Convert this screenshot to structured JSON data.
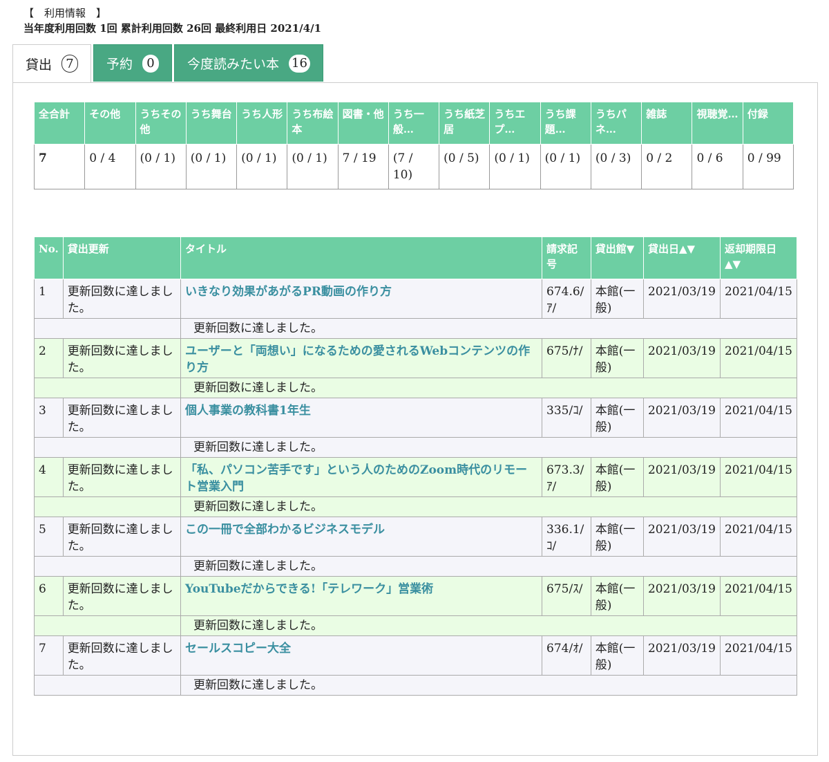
{
  "info": {
    "header": "【　利用情報　】",
    "stats_line": "当年度利用回数 1回  累計利用回数 26回  最終利用日 2021/4/1"
  },
  "tabs": [
    {
      "label": "貸出",
      "count": "7"
    },
    {
      "label": "予約",
      "count": "0"
    },
    {
      "label": "今度読みたい本",
      "count": "16"
    }
  ],
  "summary": {
    "headers": [
      "全合計",
      "その他",
      "うちその他",
      "うち舞台",
      "うち人形",
      "うち布絵本",
      "図書・他",
      "うち一般…",
      "うち紙芝居",
      "うちエプ…",
      "うち課題…",
      "うちパネ…",
      "雑誌",
      "視聴覚…",
      "付録"
    ],
    "values": [
      "7",
      "0 / 4",
      "(0 / 1)",
      "(0 / 1)",
      "(0 / 1)",
      "(0 / 1)",
      "7 / 19",
      "(7 / 10)",
      "(0 / 5)",
      "(0 / 1)",
      "(0 / 1)",
      "(0 / 3)",
      "0 / 2",
      "0 / 6",
      "0 / 99"
    ]
  },
  "loans": {
    "headers": [
      "No.",
      "貸出更新",
      "タイトル",
      "請求記号",
      "貸出館▼",
      "貸出日▲▼",
      "返却期限日▲▼"
    ],
    "rows": [
      {
        "no": "1",
        "renew": "更新回数に達しました。",
        "title": "いきなり効果があがるPR動画の作り方",
        "call": "674.6/ｱ/",
        "branch": "本館(一般)",
        "loan_date": "2021/03/19",
        "due": "2021/04/15",
        "note": "更新回数に達しました。"
      },
      {
        "no": "2",
        "renew": "更新回数に達しました。",
        "title": "ユーザーと「両想い」になるための愛されるWebコンテンツの作り方",
        "call": "675/ﾅ/",
        "branch": "本館(一般)",
        "loan_date": "2021/03/19",
        "due": "2021/04/15",
        "note": "更新回数に達しました。"
      },
      {
        "no": "3",
        "renew": "更新回数に達しました。",
        "title": "個人事業の教科書1年生",
        "call": "335/ｺ/",
        "branch": "本館(一般)",
        "loan_date": "2021/03/19",
        "due": "2021/04/15",
        "note": "更新回数に達しました。"
      },
      {
        "no": "4",
        "renew": "更新回数に達しました。",
        "title": "「私、パソコン苦手です」という人のためのZoom時代のリモート営業入門",
        "call": "673.3/ｱ/",
        "branch": "本館(一般)",
        "loan_date": "2021/03/19",
        "due": "2021/04/15",
        "note": "更新回数に達しました。"
      },
      {
        "no": "5",
        "renew": "更新回数に達しました。",
        "title": "この一冊で全部わかるビジネスモデル",
        "call": "336.1/ｺ/",
        "branch": "本館(一般)",
        "loan_date": "2021/03/19",
        "due": "2021/04/15",
        "note": "更新回数に達しました。"
      },
      {
        "no": "6",
        "renew": "更新回数に達しました。",
        "title": "YouTubeだからできる!「テレワーク」営業術",
        "call": "675/ｽ/",
        "branch": "本館(一般)",
        "loan_date": "2021/03/19",
        "due": "2021/04/15",
        "note": "更新回数に達しました。"
      },
      {
        "no": "7",
        "renew": "更新回数に達しました。",
        "title": "セールスコピー大全",
        "call": "674/ｵ/",
        "branch": "本館(一般)",
        "loan_date": "2021/03/19",
        "due": "2021/04/15",
        "note": "更新回数に達しました。"
      }
    ]
  },
  "colors": {
    "header_green": "#6dcfa3",
    "tab_green": "#49a883",
    "title_link": "#3a8fa0",
    "row_odd": "#f5f5fa",
    "row_even": "#eafde4"
  }
}
